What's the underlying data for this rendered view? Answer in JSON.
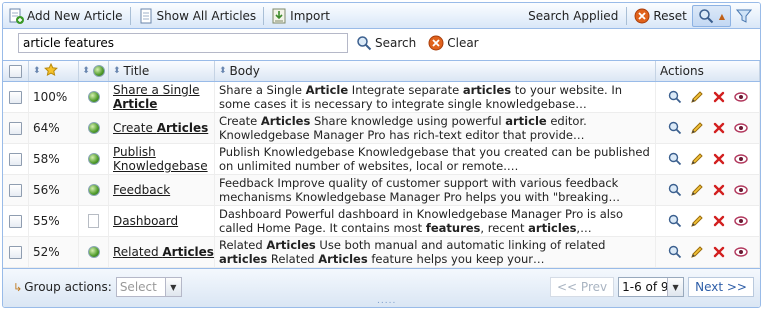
{
  "toolbar": {
    "add_new_label": "Add New Article",
    "show_all_label": "Show All Articles",
    "import_label": "Import",
    "search_applied_label": "Search Applied",
    "reset_label": "Reset"
  },
  "search": {
    "value": "article features",
    "search_label": "Search",
    "clear_label": "Clear"
  },
  "grid": {
    "columns": {
      "title": "Title",
      "body": "Body",
      "actions": "Actions"
    },
    "rows": [
      {
        "relevance": "100%",
        "icon": "globe-icon",
        "title": "Share a Single Article",
        "title_html": "Share a Single <b>Article</b>",
        "body_html": "Share a Single <b>Article</b> Integrate separate <b>articles</b> to your website. In some cases it is necessary to integrate single knowledgebase…"
      },
      {
        "relevance": "64%",
        "icon": "globe-icon",
        "title": "Create Articles",
        "title_html": "Create <b>Articles</b>",
        "body_html": "Create <b>Articles</b> Share knowledge using powerful <b>article</b> editor. Knowledgebase Manager Pro has rich-text editor that provide…"
      },
      {
        "relevance": "58%",
        "icon": "globe-icon",
        "title": "Publish Knowledgebase",
        "title_html": "Publish Knowledgebase",
        "body_html": "Publish Knowledgebase Knowledgebase that you created can be published on unlimited number of websites, local or remote.…"
      },
      {
        "relevance": "56%",
        "icon": "globe-icon",
        "title": "Feedback",
        "title_html": "Feedback",
        "body_html": "Feedback Improve quality of customer support with various feedback mechanisms Knowledgebase Manager Pro helps you with \"breaking…"
      },
      {
        "relevance": "55%",
        "icon": "doc-icon",
        "title": "Dashboard",
        "title_html": "Dashboard",
        "body_html": "Dashboard Powerful dashboard in Knowledgebase Manager Pro is also called Home Page. It contains most <b>features</b>, recent <b>articles</b>,…"
      },
      {
        "relevance": "52%",
        "icon": "globe-icon",
        "title": "Related Articles",
        "title_html": "Related <b>Articles</b>",
        "body_html": "Related <b>Articles</b> Use both manual and automatic linking of related <b>articles</b> Related <b>Articles</b> feature helps you keep your…"
      }
    ]
  },
  "footer": {
    "group_actions_label": "Group actions:",
    "group_select_placeholder": "Select",
    "prev_label": "<< Prev",
    "page_value": "1-6 of 9",
    "next_label": "Next >>",
    "resize_dots": "....."
  }
}
